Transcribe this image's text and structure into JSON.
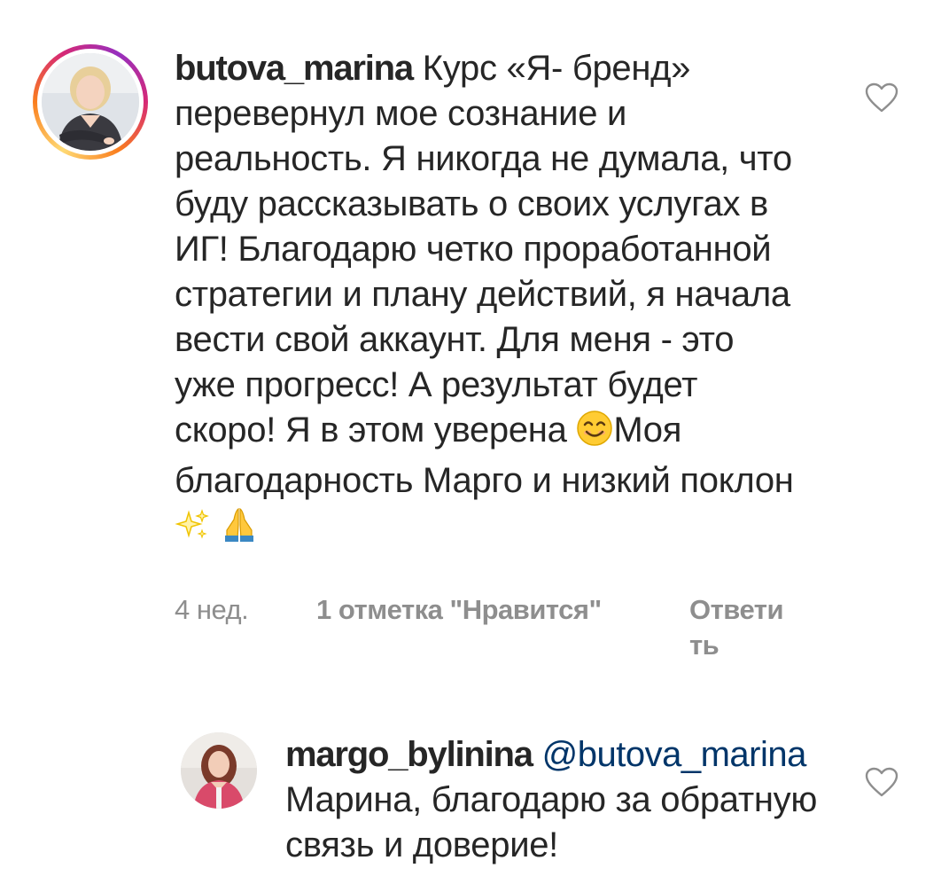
{
  "comments": [
    {
      "username": "butova_marina",
      "text_before_emoji": " Курс «Я- бренд» перевернул мое сознание и реальность. Я никогда не думала, что буду рассказывать о своих услугах в ИГ! Благодарю четко проработанной стратегии и плану действий, я начала вести свой аккаунт. Для меня - это уже прогресс! А результат будет скоро! Я в этом уверена ",
      "text_after_emoji": "Моя благодарность Марго и низкий поклон",
      "emojis": [
        "smiling-face-icon",
        "sparkles-icon",
        "folded-hands-icon"
      ],
      "time": "4 нед.",
      "likes": "1 отметка \"Нравится\"",
      "reply": "Ответить",
      "like_icon": "heart-outline-icon"
    },
    {
      "username": "margo_bylinina",
      "mention": "@butova_marina",
      "text": "Марина, благодарю за обратную связь и доверие!",
      "like_icon": "heart-outline-icon"
    }
  ],
  "colors": {
    "text": "#262626",
    "secondary": "#8e8e8e",
    "mention": "#003569",
    "story_ring": [
      "#feda75",
      "#fa7e1e",
      "#d62976",
      "#962fbf"
    ]
  }
}
